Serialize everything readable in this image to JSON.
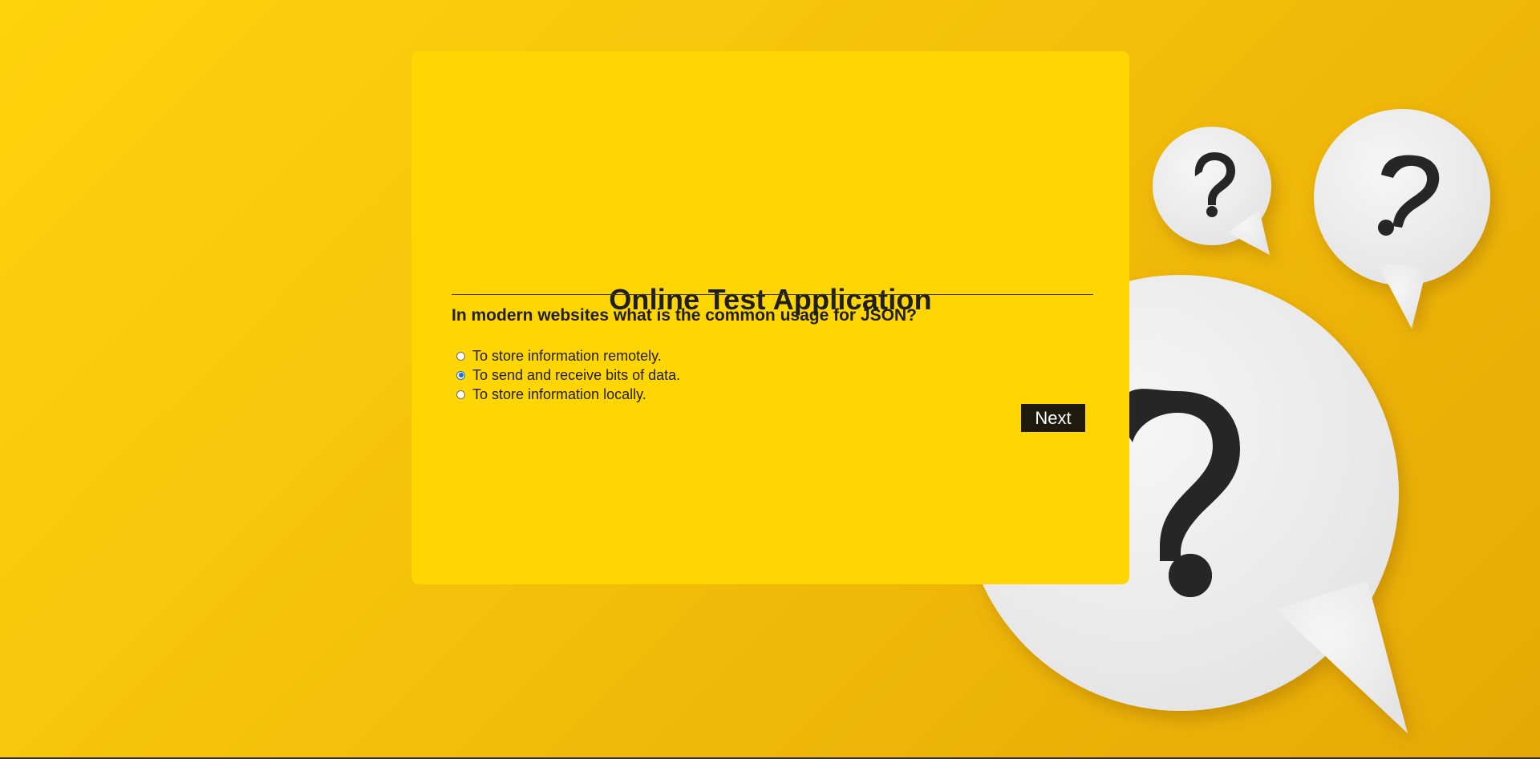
{
  "app": {
    "title": "Online Test Application"
  },
  "quiz": {
    "question": "In modern websites what is the common usage for JSON?",
    "options": [
      {
        "label": "To store information remotely.",
        "selected": false
      },
      {
        "label": "To send and receive bits of data.",
        "selected": true
      },
      {
        "label": "To store information locally.",
        "selected": false
      }
    ],
    "next_label": "Next"
  },
  "colors": {
    "background": "#f2bd0a",
    "card": "#ffd502",
    "button": "#1e1a0e",
    "radio_selected": "#1f6fd1"
  },
  "decorations": {
    "icons": [
      "speech-bubble-question-icon",
      "speech-bubble-question-icon",
      "speech-bubble-question-icon"
    ]
  }
}
